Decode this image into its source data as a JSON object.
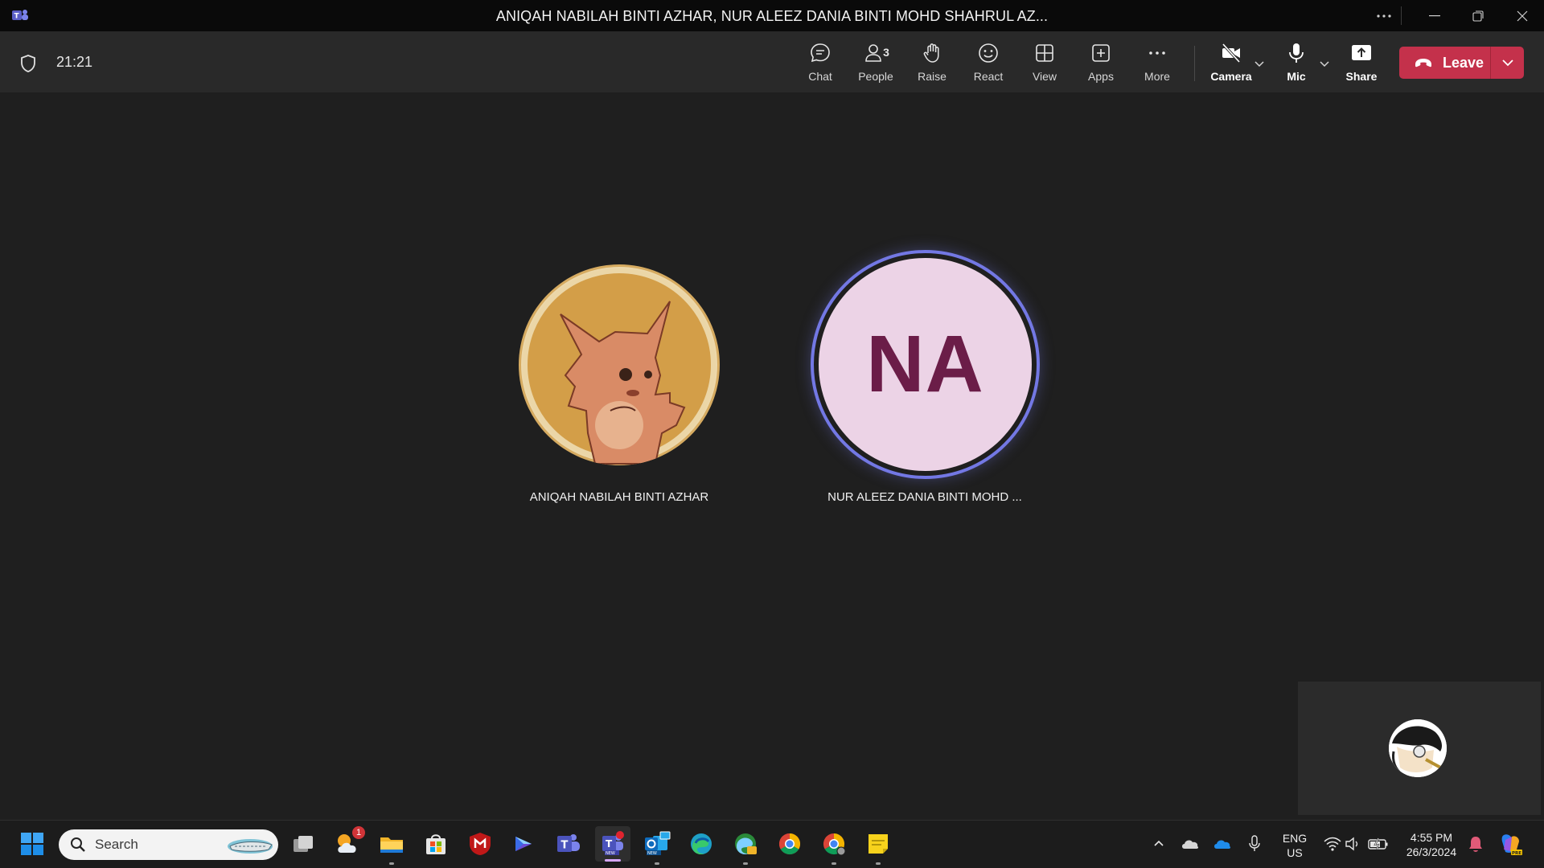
{
  "window": {
    "title": "ANIQAH NABILAH BINTI AZHAR, NUR ALEEZ DANIA BINTI MOHD SHAHRUL AZ...",
    "controls": [
      "more-icon",
      "minimize-icon",
      "restore-icon",
      "close-icon"
    ]
  },
  "meeting": {
    "timer": "21:21",
    "toolbar": {
      "chat": "Chat",
      "people": "People",
      "people_count": "3",
      "raise": "Raise",
      "react": "React",
      "view": "View",
      "apps": "Apps",
      "more": "More",
      "camera": "Camera",
      "mic": "Mic",
      "share": "Share",
      "leave": "Leave"
    },
    "colors": {
      "leave": "#c4314b",
      "speaking_ring": "#7378e4",
      "initials_bg": "#ecd3e6",
      "initials_text": "#6b1d48"
    }
  },
  "participants": [
    {
      "name": "ANIQAH NABILAH BINTI AZHAR",
      "avatar": "fox-drawing-avatar"
    },
    {
      "name": "NUR ALEEZ DANIA BINTI MOHD ...",
      "initials": "NA",
      "speaking": true
    }
  ],
  "self_view": {
    "avatar": "anime-avatar"
  },
  "taskbar": {
    "search_placeholder": "Search",
    "weather_badge": "1",
    "apps": [
      "start-icon",
      "search-icon",
      "task-view-icon",
      "weather-icon",
      "file-explorer-icon",
      "microsoft-store-icon",
      "mcafee-icon",
      "copilot-icon",
      "teams-classic-icon",
      "teams-new-icon",
      "outlook-new-icon",
      "edge-icon",
      "edge-dev-icon",
      "chrome-icon",
      "chrome-profile-icon",
      "sticky-notes-icon"
    ],
    "tray": {
      "lang_top": "ENG",
      "lang_bottom": "US",
      "time": "4:55 PM",
      "date": "26/3/2024"
    }
  }
}
